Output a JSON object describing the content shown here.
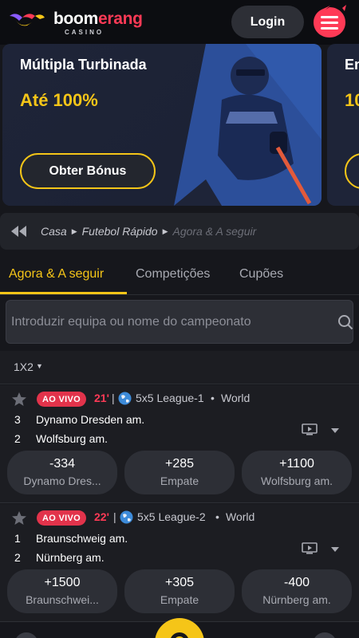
{
  "header": {
    "logo_word_1": "boom",
    "logo_word_2": "erang",
    "logo_sub": "CASINO",
    "login_label": "Login",
    "menu_icon": "hamburger-menu-icon"
  },
  "promo": {
    "title": "Múltipla Turbinada",
    "subtitle": "Até 100%",
    "button_label": "Obter Bónus",
    "next_title": "En",
    "next_subtitle": "10"
  },
  "breadcrumb": {
    "items": [
      "Casa",
      "Futebol Rápido",
      "Agora & A seguir"
    ]
  },
  "tabs": [
    {
      "label": "Agora & A seguir",
      "active": true
    },
    {
      "label": "Competições",
      "active": false
    },
    {
      "label": "Cupões",
      "active": false
    }
  ],
  "search": {
    "placeholder": "Introduzir equipa ou nome do campeonato"
  },
  "market": {
    "selected": "1X2"
  },
  "events": [
    {
      "status": "AO VIVO",
      "minute": "21'",
      "league": "5x5 League-1",
      "region": "World",
      "teams": [
        {
          "num": "3",
          "name": "Dynamo Dresden am."
        },
        {
          "num": "2",
          "name": "Wolfsburg am."
        }
      ],
      "odds": [
        {
          "value": "-334",
          "label": "Dynamo Dres..."
        },
        {
          "value": "+285",
          "label": "Empate"
        },
        {
          "value": "+1100",
          "label": "Wolfsburg am."
        }
      ]
    },
    {
      "status": "AO VIVO",
      "minute": "22'",
      "league": "5x5 League-2",
      "region": "World",
      "teams": [
        {
          "num": "1",
          "name": "Braunschweig am."
        },
        {
          "num": "2",
          "name": "Nürnberg am."
        }
      ],
      "odds": [
        {
          "value": "+1500",
          "label": "Braunschwei..."
        },
        {
          "value": "+305",
          "label": "Empate"
        },
        {
          "value": "-400",
          "label": "Nürnberg am."
        }
      ]
    }
  ],
  "colors": {
    "accent_yellow": "#f5c518",
    "brand_red": "#ff3a56",
    "live_red": "#e2334b",
    "background": "#16171c"
  }
}
